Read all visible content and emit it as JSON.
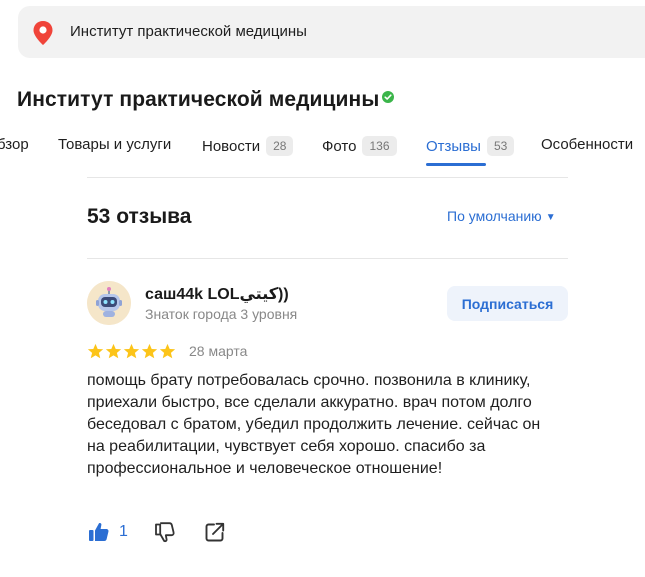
{
  "search": {
    "query": "Институт практической медицины"
  },
  "org": {
    "title": "Институт практической медицины"
  },
  "tabs": [
    {
      "label": "бзор",
      "count": ""
    },
    {
      "label": "Товары и услуги",
      "count": ""
    },
    {
      "label": "Новости",
      "count": "28"
    },
    {
      "label": "Фото",
      "count": "136"
    },
    {
      "label": "Отзывы",
      "count": "53"
    },
    {
      "label": "Особенности",
      "count": ""
    }
  ],
  "active_tab": "Отзывы",
  "reviews": {
    "count_label": "53 отзыва",
    "sort_label": "По умолчанию"
  },
  "review": {
    "author": "саш44k LOLكيتي))",
    "level": "Знаток города 3 уровня",
    "subscribe_label": "Подписаться",
    "rating": 5,
    "date": "28 марта",
    "text": "помощь брату потребовалась срочно. позвонила в клинику, приехали быстро, все сделали аккуратно. врач потом долго беседовал с братом, убедил продолжить лечение. сейчас он на реабилитации, чувствует себя хорошо. спасибо за профессиональное и человеческое отношение!",
    "likes": "1"
  },
  "colors": {
    "accent": "#2b6ed3",
    "star": "#fcc419",
    "pin": "#f0443a",
    "verified": "#3bb54a"
  },
  "icons": [
    "map-pin-icon",
    "verified-icon",
    "caret-down-icon",
    "star-icon",
    "thumbs-up-icon",
    "thumbs-down-icon",
    "share-icon"
  ]
}
